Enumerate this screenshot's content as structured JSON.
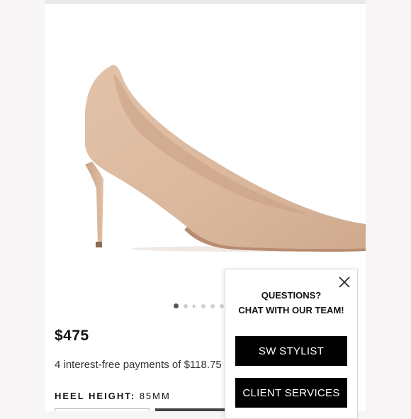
{
  "product": {
    "image_name": "nude suede pointed-toe pump",
    "price": "$475",
    "installments": "4 interest-free payments of $118.75 w",
    "heel_height_label": "HEEL HEIGHT:",
    "heel_height_value": "85MM",
    "gallery": {
      "total_items": 6,
      "active_index": 0,
      "has_video": true
    }
  },
  "chat": {
    "line1": "QUESTIONS?",
    "line2": "CHAT WITH OUR TEAM!",
    "stylist_button": "SW STYLIST",
    "services_button": "CLIENT SERVICES",
    "close_icon": "close-icon"
  },
  "colors": {
    "shoe": "#dbb79d",
    "button_bg": "#000000",
    "button_text": "#ffffff"
  }
}
